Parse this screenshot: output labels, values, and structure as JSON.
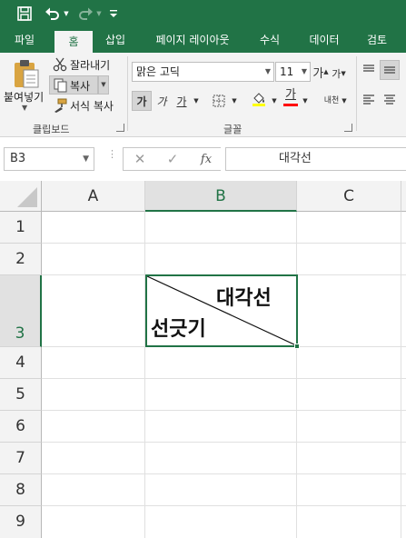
{
  "quick_access": {
    "save_icon": "save-icon",
    "undo_icon": "undo-icon",
    "redo_icon": "redo-icon",
    "customize_icon": "customize-qat-icon"
  },
  "tabs": [
    {
      "label": "파일"
    },
    {
      "label": "홈",
      "active": true
    },
    {
      "label": "삽입"
    },
    {
      "label": "페이지 레이아웃"
    },
    {
      "label": "수식"
    },
    {
      "label": "데이터"
    },
    {
      "label": "검토"
    }
  ],
  "ribbon": {
    "clipboard": {
      "paste_label": "붙여넣기",
      "cut_label": "잘라내기",
      "copy_label": "복사",
      "format_painter_label": "서식 복사",
      "group_label": "클립보드"
    },
    "font": {
      "font_name": "맑은 고딕",
      "font_size": "11",
      "grow_label": "가",
      "shrink_label": "가",
      "bold_label": "가",
      "italic_label": "가",
      "underline_label": "가",
      "font_color_label": "가",
      "phonetic_label": "내천",
      "group_label": "글꼴"
    },
    "accent_colors": {
      "highlight": "#ffff00",
      "font_color": "#ff0000"
    }
  },
  "formula_bar": {
    "name_box": "B3",
    "cancel_icon": "✕",
    "enter_icon": "✓",
    "function_label": "fx",
    "content": "대각선"
  },
  "grid": {
    "columns": [
      "A",
      "B",
      "C"
    ],
    "rows": [
      "1",
      "2",
      "3",
      "4",
      "5",
      "6",
      "7",
      "8",
      "9"
    ],
    "selected_column": "B",
    "selected_row": "3"
  },
  "cell_b3": {
    "top_right_text": "대각선",
    "bottom_left_text": "선긋기"
  },
  "colors": {
    "accent": "#217346",
    "ribbon_bg": "#f3f3f3"
  }
}
